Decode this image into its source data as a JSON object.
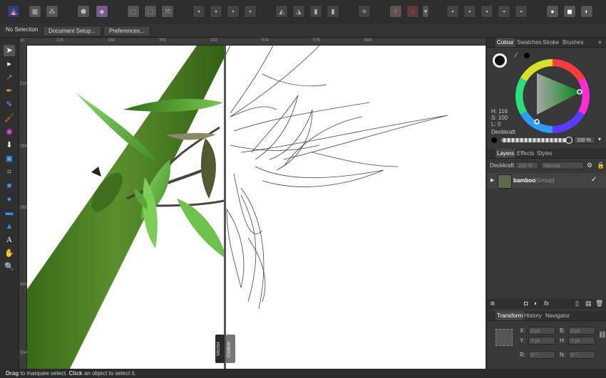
{
  "context_bar": {
    "selection": "No Selection",
    "document_setup": "Document Setup...",
    "preferences": "Preferences..."
  },
  "rulers": {
    "top": [
      "216",
      "288",
      "360",
      "432",
      "504",
      "576",
      "648"
    ],
    "left": [
      "216",
      "288",
      "360",
      "432",
      "504"
    ]
  },
  "split_view": {
    "left_label": "Vector",
    "right_label": "Outline"
  },
  "colour_panel": {
    "tabs": [
      "Colour",
      "Swatches",
      "Stroke",
      "Brushes"
    ],
    "h": "H: 116",
    "s": "S: 100",
    "l": "L: 0",
    "opacity_label": "Deckkraft",
    "opacity_value": "100 %"
  },
  "layers_panel": {
    "tabs": [
      "Layers",
      "Effects",
      "Styles"
    ],
    "opacity_label": "Deckkraft:",
    "opacity_value": "100 %",
    "blend_mode": "Normal",
    "layer_name": "bamboo",
    "layer_type": "(Group)"
  },
  "transform_panel": {
    "tabs": [
      "Transform",
      "History",
      "Navigator"
    ],
    "x_label": "X:",
    "x_value": "0 pt",
    "y_label": "Y:",
    "y_value": "0 pt",
    "b_label": "B:",
    "b_value": "0 pt",
    "h_label": "H:",
    "h_value": "0 pt",
    "r_label": "R:",
    "r_value": "0 °",
    "n_label": "N:",
    "n_value": "0 °"
  },
  "status": {
    "drag": "Drag",
    "drag_text": " to marquee select. ",
    "click": "Click",
    "click_text": " an object to select it."
  },
  "colors": {
    "accent": "#4f7ee6",
    "bamboo_dark": "#3f6f1d",
    "leaf_light": "#6cc24a"
  }
}
